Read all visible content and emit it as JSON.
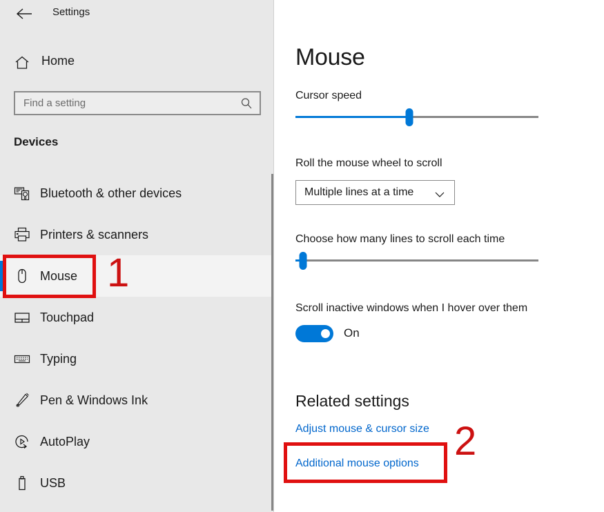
{
  "window": {
    "title": "Settings",
    "back_icon": "back-arrow-icon"
  },
  "sidebar": {
    "home": {
      "label": "Home",
      "icon": "home-icon"
    },
    "search": {
      "placeholder": "Find a setting",
      "value": "",
      "icon": "search-icon"
    },
    "section_header": "Devices",
    "items": [
      {
        "label": "Bluetooth & other devices",
        "icon": "bluetooth-devices-icon",
        "selected": false
      },
      {
        "label": "Printers & scanners",
        "icon": "printer-icon",
        "selected": false
      },
      {
        "label": "Mouse",
        "icon": "mouse-icon",
        "selected": true
      },
      {
        "label": "Touchpad",
        "icon": "touchpad-icon",
        "selected": false
      },
      {
        "label": "Typing",
        "icon": "keyboard-icon",
        "selected": false
      },
      {
        "label": "Pen & Windows Ink",
        "icon": "pen-icon",
        "selected": false
      },
      {
        "label": "AutoPlay",
        "icon": "autoplay-icon",
        "selected": false
      },
      {
        "label": "USB",
        "icon": "usb-icon",
        "selected": false
      }
    ]
  },
  "main": {
    "page_title": "Mouse",
    "cursor_speed": {
      "label": "Cursor speed",
      "value_percent": 47
    },
    "wheel_scroll": {
      "label": "Roll the mouse wheel to scroll",
      "selected_option": "Multiple lines at a time",
      "chevron_icon": "chevron-down-icon"
    },
    "lines_to_scroll": {
      "label": "Choose how many lines to scroll each time",
      "value_percent": 3
    },
    "scroll_inactive": {
      "label": "Scroll inactive windows when I hover over them",
      "state": "On"
    },
    "related_settings": {
      "title": "Related settings",
      "links": [
        {
          "label": "Adjust mouse & cursor size"
        },
        {
          "label": "Additional mouse options"
        }
      ]
    }
  },
  "annotations": {
    "step_one": "1",
    "step_two": "2",
    "box_color": "#e01010",
    "number_color": "#cc1111"
  },
  "colors": {
    "accent": "#0078d7",
    "link": "#0066cc",
    "sidebar_bg": "#e8e8e8",
    "selected_bg": "#f3f3f3"
  }
}
